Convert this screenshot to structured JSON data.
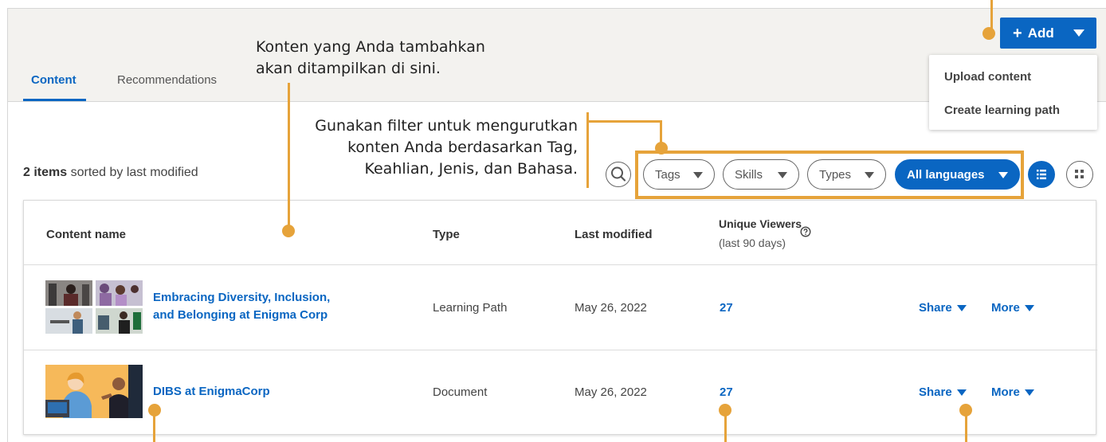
{
  "tabs": [
    {
      "label": "Content",
      "active": true
    },
    {
      "label": "Recommendations",
      "active": false
    }
  ],
  "add_button": {
    "label": "Add",
    "icon": "plus-icon"
  },
  "add_menu": [
    "Upload content",
    "Create learning path"
  ],
  "summary": {
    "count": "2 items",
    "rest": " sorted by last modified"
  },
  "filters": {
    "search_icon": "search-icon",
    "tags": "Tags",
    "skills": "Skills",
    "types": "Types",
    "languages": "All languages"
  },
  "table": {
    "headers": {
      "name": "Content name",
      "type": "Type",
      "modified": "Last modified",
      "viewers": "Unique Viewers",
      "viewers_sub": "(last 90 days)"
    },
    "rows": [
      {
        "title_line1": "Embracing Diversity, Inclusion,",
        "title_line2": "and Belonging at Enigma Corp",
        "type": "Learning Path",
        "modified": "May 26, 2022",
        "viewers": "27",
        "share": "Share",
        "more": "More"
      },
      {
        "title_line1": "DIBS at EnigmaCorp",
        "title_line2": "",
        "type": "Document",
        "modified": "May 26, 2022",
        "viewers": "27",
        "share": "Share",
        "more": "More"
      }
    ]
  },
  "annotations": {
    "content_line1": "Konten yang Anda tambahkan",
    "content_line2": "akan ditampilkan di sini.",
    "filter_line1": "Gunakan filter untuk mengurutkan",
    "filter_line2": "konten Anda berdasarkan Tag,",
    "filter_line3": "Keahlian, Jenis, dan Bahasa."
  },
  "colors": {
    "accent": "#0a66c2",
    "annotation": "#e6a33a",
    "header_bg": "#f3f2ef"
  }
}
